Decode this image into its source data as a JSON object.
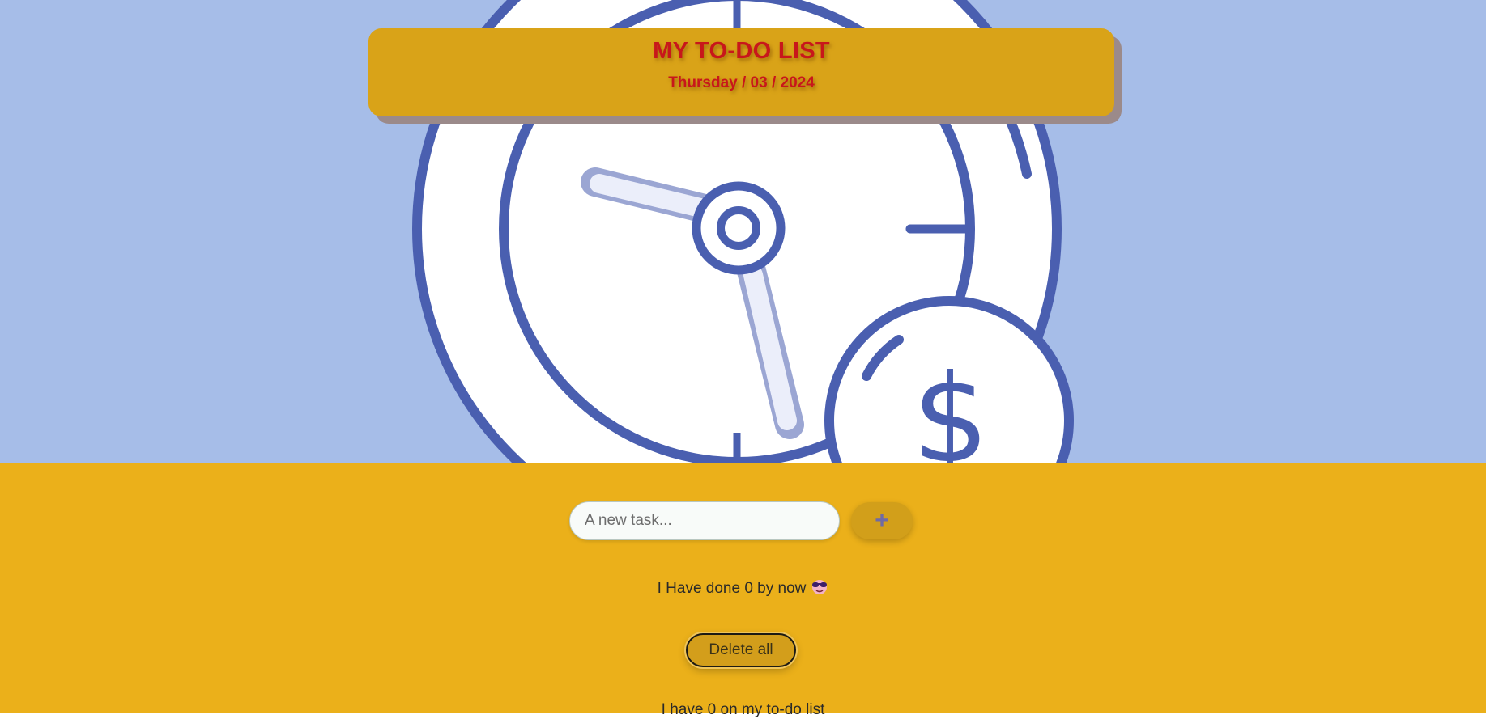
{
  "header": {
    "title": "MY TO-DO LIST",
    "date": "Thursday / 03 / 2024"
  },
  "hero": {
    "icon": "clock-dollar-icon",
    "colors": {
      "background": "#a6bde8",
      "stroke": "#4a5fb0",
      "fill": "#ffffff"
    }
  },
  "task_form": {
    "placeholder": "A new task...",
    "add_label": "+"
  },
  "stats": {
    "done_text": "I Have done 0 by now",
    "done_emoji": "sunglasses-face-icon",
    "delete_all_label": "Delete all",
    "count_text": "I have 0 on my to-do list"
  },
  "colors": {
    "page_bottom": "#ebb01a",
    "header_card": "#d9a318",
    "title": "#c8171b"
  }
}
